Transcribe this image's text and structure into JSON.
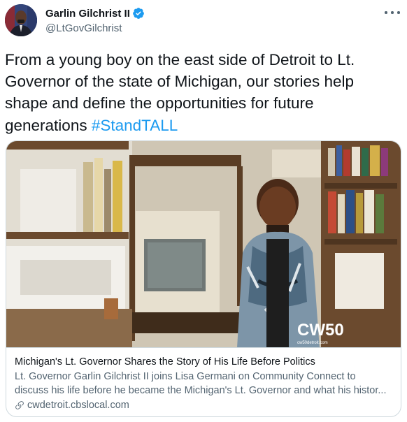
{
  "author": {
    "display_name": "Garlin Gilchrist II",
    "handle": "@LtGovGilchrist",
    "verified": true,
    "avatar_icon": "profile-photo"
  },
  "tweet": {
    "text_lines": [
      "From a young boy on the east side of Detroit to Lt.",
      "Governor of the state of Michigan, our stories help",
      "shape and define the opportunities for future",
      "generations "
    ],
    "hashtag": "#StandTALL"
  },
  "card": {
    "image_watermark": "CW50",
    "image_watermark_sub": "cw50detroit.com",
    "title": "Michigan's Lt. Governor Shares the Story of His Life Before Politics",
    "description_lines": [
      "Lt. Governor Garlin Gilchrist II joins Lisa Germani on Community Connect to",
      "discuss his life before he became the Michigan's Lt. Governor and what his histor..."
    ],
    "domain": "cwdetroit.cbslocal.com"
  },
  "colors": {
    "accent": "#1d9bf0",
    "text_primary": "#0f1419",
    "text_secondary": "#536471",
    "border": "#cfd9de"
  }
}
